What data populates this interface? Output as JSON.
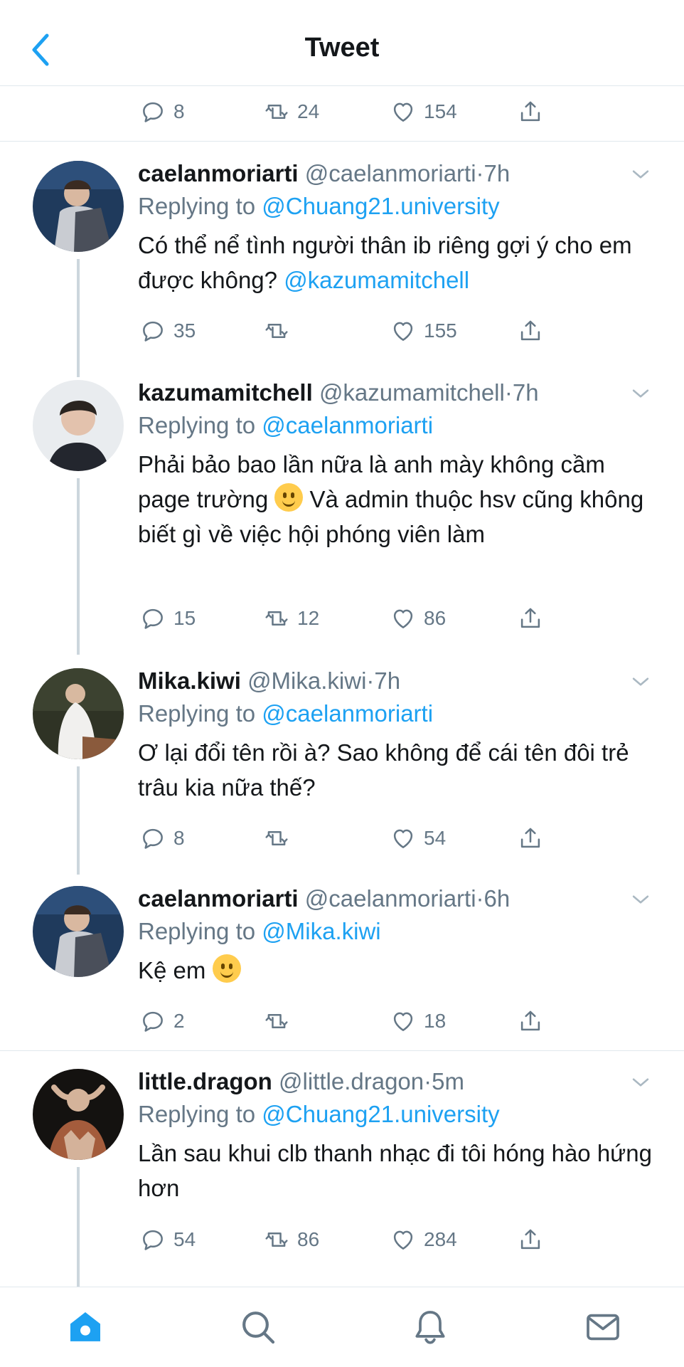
{
  "header": {
    "title": "Tweet"
  },
  "top_actions": {
    "replies": "8",
    "retweets": "24",
    "likes": "154"
  },
  "tweets": [
    {
      "name": "caelanmoriarti",
      "handle": "@caelanmoriarti",
      "dot": "·",
      "time": "7h",
      "reply_prefix": "Replying to",
      "reply_to": "@Chuang21.university",
      "text": "Có thể nể tình người thân ib riêng gợi ý cho em được không? ",
      "mention": "@kazumamitchell",
      "replies": "35",
      "retweets": "",
      "likes": "155"
    },
    {
      "name": "kazumamitchell",
      "handle": "@kazumamitchell",
      "dot": "·",
      "time": "7h",
      "reply_prefix": "Replying to",
      "reply_to": "@caelanmoriarti",
      "text_before_emoji": "Phải bảo bao lần nữa là anh mày không cầm page trường ",
      "text_after_emoji": " Và admin thuộc hsv cũng không biết gì về việc hội phóng viên làm",
      "replies": "15",
      "retweets": "12",
      "likes": "86"
    },
    {
      "name": "Mika.kiwi",
      "handle": "@Mika.kiwi",
      "dot": "·",
      "time": "7h",
      "reply_prefix": "Replying to",
      "reply_to": "@caelanmoriarti",
      "text": "Ơ lại đổi tên rồi à? Sao không để cái tên đôi trẻ trâu kia nữa thế?",
      "replies": "8",
      "retweets": "",
      "likes": "54"
    },
    {
      "name": "caelanmoriarti",
      "handle": "@caelanmoriarti",
      "dot": "·",
      "time": "6h",
      "reply_prefix": "Replying to",
      "reply_to": "@Mika.kiwi",
      "text_before_emoji": "Kệ em ",
      "replies": "2",
      "retweets": "",
      "likes": "18"
    },
    {
      "name": "little.dragon",
      "handle": "@little.dragon",
      "dot": "·",
      "time": "5m",
      "reply_prefix": "Replying to",
      "reply_to": "@Chuang21.university",
      "text": "Lần sau khui clb thanh nhạc đi tôi hóng hào hứng hơn",
      "replies": "54",
      "retweets": "86",
      "likes": "284"
    }
  ],
  "icons": {
    "back": "chevron-left-icon",
    "reply": "reply-icon",
    "retweet": "retweet-icon",
    "like": "heart-icon",
    "share": "share-icon",
    "more": "chevron-down-icon",
    "tab_home": "home-icon",
    "tab_search": "search-icon",
    "tab_notifications": "bell-icon",
    "tab_messages": "mail-icon"
  },
  "colors": {
    "accent": "#1da1f2",
    "muted": "#657786",
    "divider": "#e1e8ed",
    "thread": "#ccd6dd"
  }
}
